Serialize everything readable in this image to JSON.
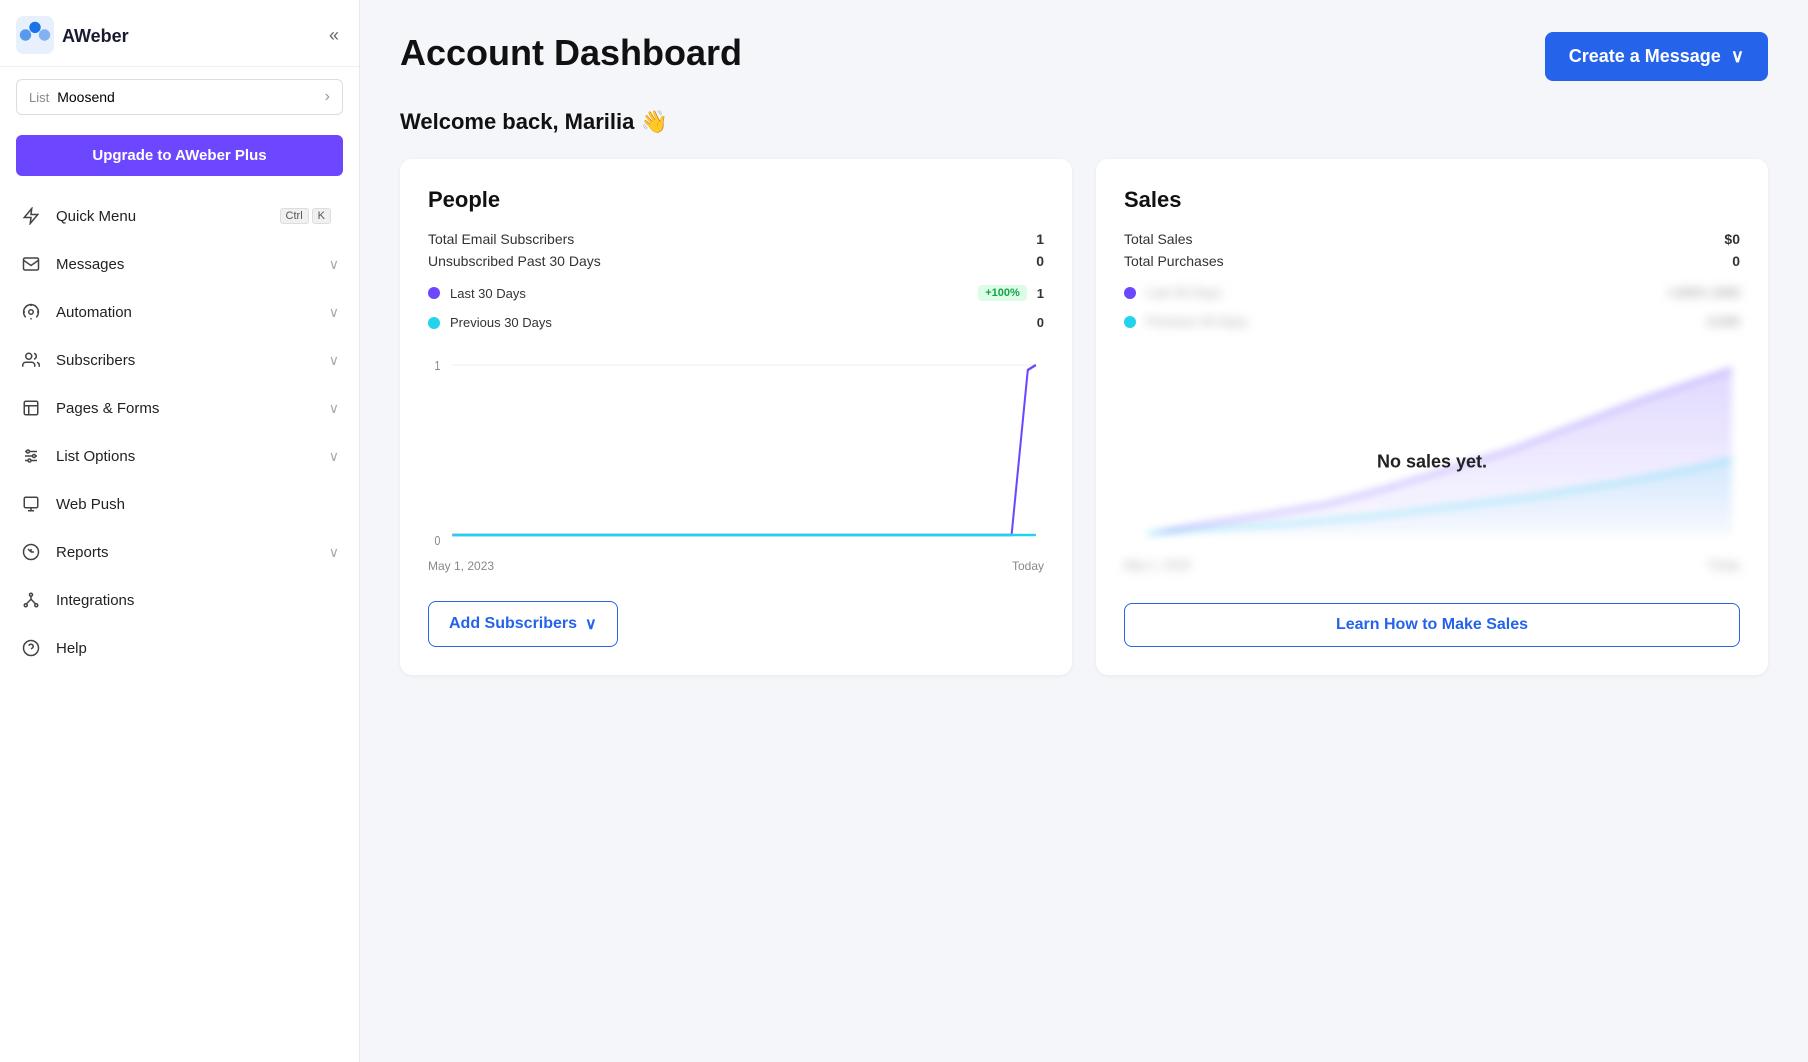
{
  "sidebar": {
    "logo_alt": "AWeber",
    "collapse_icon": "«",
    "list_label": "List",
    "list_name": "Moosend",
    "upgrade_label": "Upgrade to AWeber Plus",
    "nav_items": [
      {
        "id": "quick-menu",
        "label": "Quick Menu",
        "icon": "lightning",
        "has_chevron": false,
        "shortcut": [
          "Ctrl",
          "K"
        ]
      },
      {
        "id": "messages",
        "label": "Messages",
        "icon": "envelope",
        "has_chevron": true
      },
      {
        "id": "automation",
        "label": "Automation",
        "icon": "automation",
        "has_chevron": true
      },
      {
        "id": "subscribers",
        "label": "Subscribers",
        "icon": "people",
        "has_chevron": true
      },
      {
        "id": "pages-forms",
        "label": "Pages & Forms",
        "icon": "pages",
        "has_chevron": true
      },
      {
        "id": "list-options",
        "label": "List Options",
        "icon": "sliders",
        "has_chevron": true
      },
      {
        "id": "web-push",
        "label": "Web Push",
        "icon": "webpush",
        "has_chevron": false
      },
      {
        "id": "reports",
        "label": "Reports",
        "icon": "reports",
        "has_chevron": true
      },
      {
        "id": "integrations",
        "label": "Integrations",
        "icon": "integrations",
        "has_chevron": false
      },
      {
        "id": "help",
        "label": "Help",
        "icon": "help",
        "has_chevron": false
      }
    ]
  },
  "header": {
    "page_title": "Account Dashboard",
    "create_button_label": "Create a Message",
    "welcome_text": "Welcome back, Marilia 👋"
  },
  "people_card": {
    "title": "People",
    "stats": [
      {
        "label": "Total Email Subscribers",
        "value": "1"
      },
      {
        "label": "Unsubscribed Past 30 Days",
        "value": "0"
      }
    ],
    "legend": [
      {
        "label": "Last 30 Days",
        "color": "#6c47ff",
        "badge": "+100%",
        "value": "1"
      },
      {
        "label": "Previous 30 Days",
        "color": "#22d3ee",
        "badge": null,
        "value": "0"
      }
    ],
    "chart": {
      "y_labels": [
        "1",
        "0"
      ],
      "x_labels": [
        "May 1, 2023",
        "Today"
      ]
    },
    "footer_button": "Add Subscribers"
  },
  "sales_card": {
    "title": "Sales",
    "stats": [
      {
        "label": "Total Sales",
        "value": "$0"
      },
      {
        "label": "Total Purchases",
        "value": "0"
      }
    ],
    "legend": [
      {
        "label": "Last 30 Days",
        "color": "#6c47ff",
        "blurred": true
      },
      {
        "label": "Previous 30 Days",
        "color": "#22d3ee",
        "blurred": true
      }
    ],
    "no_sales_text": "No sales yet.",
    "x_labels": [
      "May 1, 2019",
      "Today"
    ],
    "footer_button": "Learn How to Make Sales"
  }
}
